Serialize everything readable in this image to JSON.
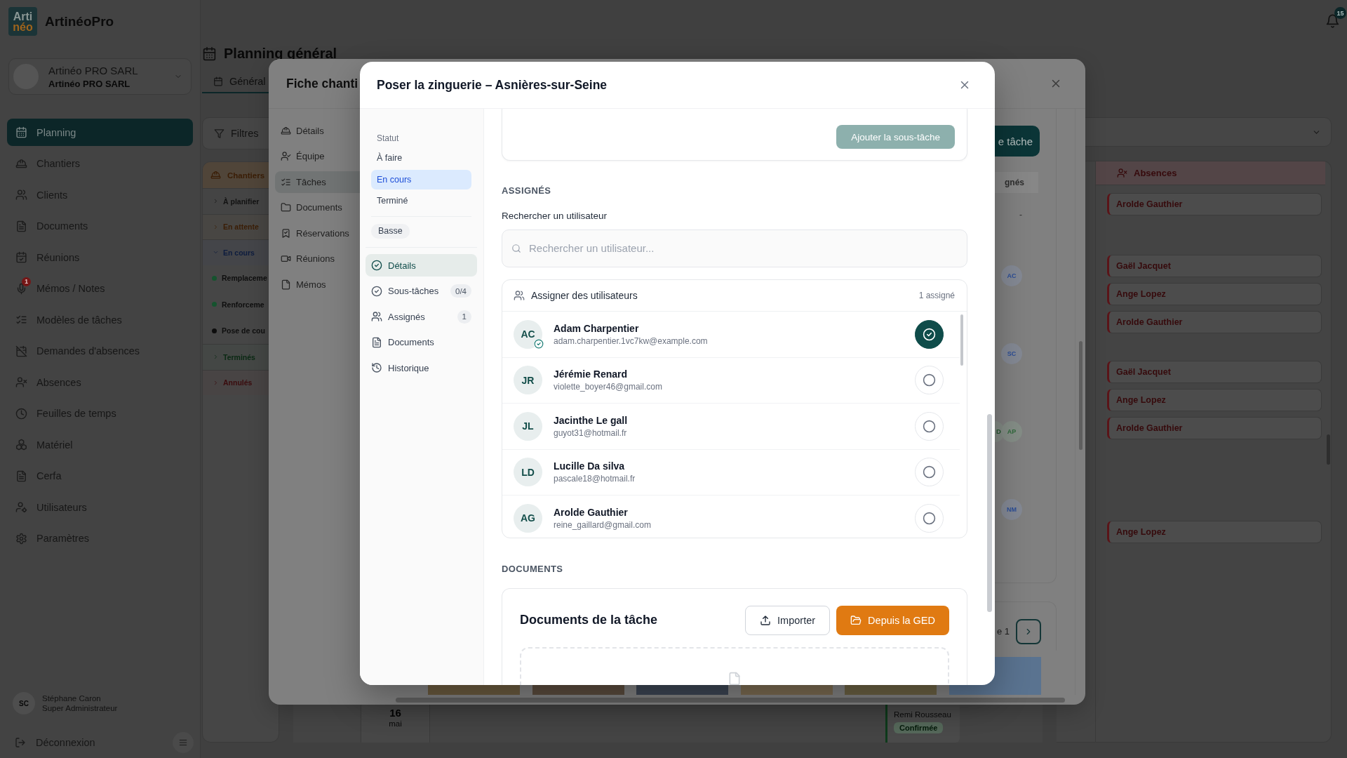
{
  "app": {
    "logo": {
      "top": "Arti",
      "bottom": "néo"
    },
    "name": "ArtinéoPro",
    "notifications": "15"
  },
  "company": {
    "name": "Artinéo PRO SARL",
    "label": "Artinéo PRO SARL"
  },
  "sidebar": {
    "items": [
      {
        "label": "Planning",
        "selected": true
      },
      {
        "label": "Chantiers",
        "selected": false
      },
      {
        "label": "Clients",
        "selected": false
      },
      {
        "label": "Documents",
        "selected": false
      },
      {
        "label": "Réunions",
        "selected": false
      },
      {
        "label": "Mémos / Notes",
        "selected": false,
        "badge": "1"
      },
      {
        "label": "Modèles de tâches",
        "selected": false
      },
      {
        "label": "Demandes d'absences",
        "selected": false
      },
      {
        "label": "Absences",
        "selected": false
      },
      {
        "label": "Feuilles de temps",
        "selected": false
      },
      {
        "label": "Matériel",
        "selected": false
      },
      {
        "label": "Cerfa",
        "selected": false
      },
      {
        "label": "Utilisateurs",
        "selected": false
      },
      {
        "label": "Paramètres",
        "selected": false
      }
    ],
    "user": {
      "initials": "SC",
      "name": "Stéphane Caron",
      "role": "Super Administrateur"
    },
    "logout": "Déconnexion"
  },
  "page": {
    "title": "Planning général",
    "tabs": [
      {
        "label": "Général",
        "selected": true
      }
    ],
    "filters_button": "Filtres",
    "chantiers": {
      "title": "Chantiers",
      "groups": [
        {
          "label": "À planifier",
          "color": "#121212",
          "expanded": false
        },
        {
          "label": "En attente",
          "color": "#3a1d05",
          "expanded": false
        },
        {
          "label": "En cours",
          "color": "#0d1c3e",
          "expanded": true,
          "children": [
            {
              "label": "Remplaceme",
              "color": "#15532e"
            },
            {
              "label": "Renforceme",
              "color": "#15532e"
            },
            {
              "label": "Pose de cou",
              "color": "#0d0d0d"
            }
          ]
        },
        {
          "label": "Terminés",
          "color": "#0a2913",
          "expanded": false
        },
        {
          "label": "Annulés",
          "color": "#3a0b0d",
          "expanded": false
        }
      ]
    },
    "absences": {
      "title": "Absences",
      "rows": [
        [
          "Arolde Gauthier"
        ],
        [
          "Gaël Jacquet",
          "Ange Lopez",
          "Arolde Gauthier"
        ],
        [
          "Gaël Jacquet",
          "Ange Lopez",
          "Arolde Gauthier"
        ],
        [
          "Ange Lopez"
        ]
      ]
    },
    "day": {
      "number": "16",
      "month": "mai"
    },
    "event": {
      "name": "Remi Rousseau",
      "status": "Confirmée"
    }
  },
  "site_sheet": {
    "title": "Fiche chanti",
    "nav": [
      {
        "label": "Détails",
        "selected": false
      },
      {
        "label": "Équipe",
        "selected": false
      },
      {
        "label": "Tâches",
        "selected": true
      },
      {
        "label": "Documents",
        "selected": false
      },
      {
        "label": "Réservations",
        "selected": false
      },
      {
        "label": "Réunions",
        "selected": false
      },
      {
        "label": "Mémos",
        "selected": false
      }
    ],
    "add_task_button": "e tâche",
    "table": {
      "column_header": "gnés",
      "rows": [
        {
          "kind": "text",
          "text": "-"
        },
        {
          "kind": "avatars",
          "avatars": [
            {
              "initials": "AC",
              "color": "#2b4d96"
            }
          ]
        },
        {
          "kind": "avatars",
          "avatars": [
            {
              "initials": "SC",
              "color": "#2b4d96"
            }
          ]
        },
        {
          "kind": "avatars",
          "avatars": [
            {
              "initials": "D",
              "color": "#23552e"
            },
            {
              "initials": "AP",
              "color": "#2f6a3b"
            }
          ]
        },
        {
          "kind": "avatars",
          "avatars": [
            {
              "initials": "NM",
              "color": "#2b4d96"
            }
          ]
        }
      ]
    },
    "pagination": {
      "label": "e 1"
    },
    "photos": [
      {
        "kind": "photo"
      },
      {
        "kind": "photo"
      },
      {
        "kind": "photo"
      },
      {
        "kind": "photo"
      },
      {
        "kind": "photo"
      },
      {
        "kind": "photo"
      }
    ]
  },
  "task_dialog": {
    "title": "Poser la zinguerie – Asnières-sur-Seine",
    "status": {
      "label": "Statut",
      "options": [
        {
          "label": "À faire",
          "selected": false
        },
        {
          "label": "En cours",
          "selected": true
        },
        {
          "label": "Terminé",
          "selected": false
        }
      ]
    },
    "priority": "Basse",
    "nav": [
      {
        "label": "Détails",
        "selected": true
      },
      {
        "label": "Sous-tâches",
        "count": "0/4",
        "selected": false
      },
      {
        "label": "Assignés",
        "count": "1",
        "selected": false
      },
      {
        "label": "Documents",
        "selected": false
      },
      {
        "label": "Historique",
        "selected": false
      }
    ],
    "add_subtask_button": {
      "label": "Ajouter la sous-tâche",
      "disabled": true
    },
    "assignees": {
      "heading": "ASSIGNÉS",
      "search_label": "Rechercher un utilisateur",
      "search_placeholder": "Rechercher un utilisateur...",
      "list_title": "Assigner des utilisateurs",
      "count": "1 assigné",
      "users": [
        {
          "initials": "AC",
          "name": "Adam Charpentier",
          "email": "adam.charpentier.1vc7kw@example.com",
          "selected": true
        },
        {
          "initials": "JR",
          "name": "Jérémie Renard",
          "email": "violette_boyer46@gmail.com",
          "selected": false
        },
        {
          "initials": "JL",
          "name": "Jacinthe Le gall",
          "email": "guyot31@hotmail.fr",
          "selected": false
        },
        {
          "initials": "LD",
          "name": "Lucille Da silva",
          "email": "pascale18@hotmail.fr",
          "selected": false
        },
        {
          "initials": "AG",
          "name": "Arolde Gauthier",
          "email": "reine_gaillard@gmail.com",
          "selected": false
        }
      ]
    },
    "documents": {
      "heading": "DOCUMENTS",
      "card_title": "Documents de la tâche",
      "import_button": "Importer",
      "ged_button": "Depuis la GED"
    }
  }
}
